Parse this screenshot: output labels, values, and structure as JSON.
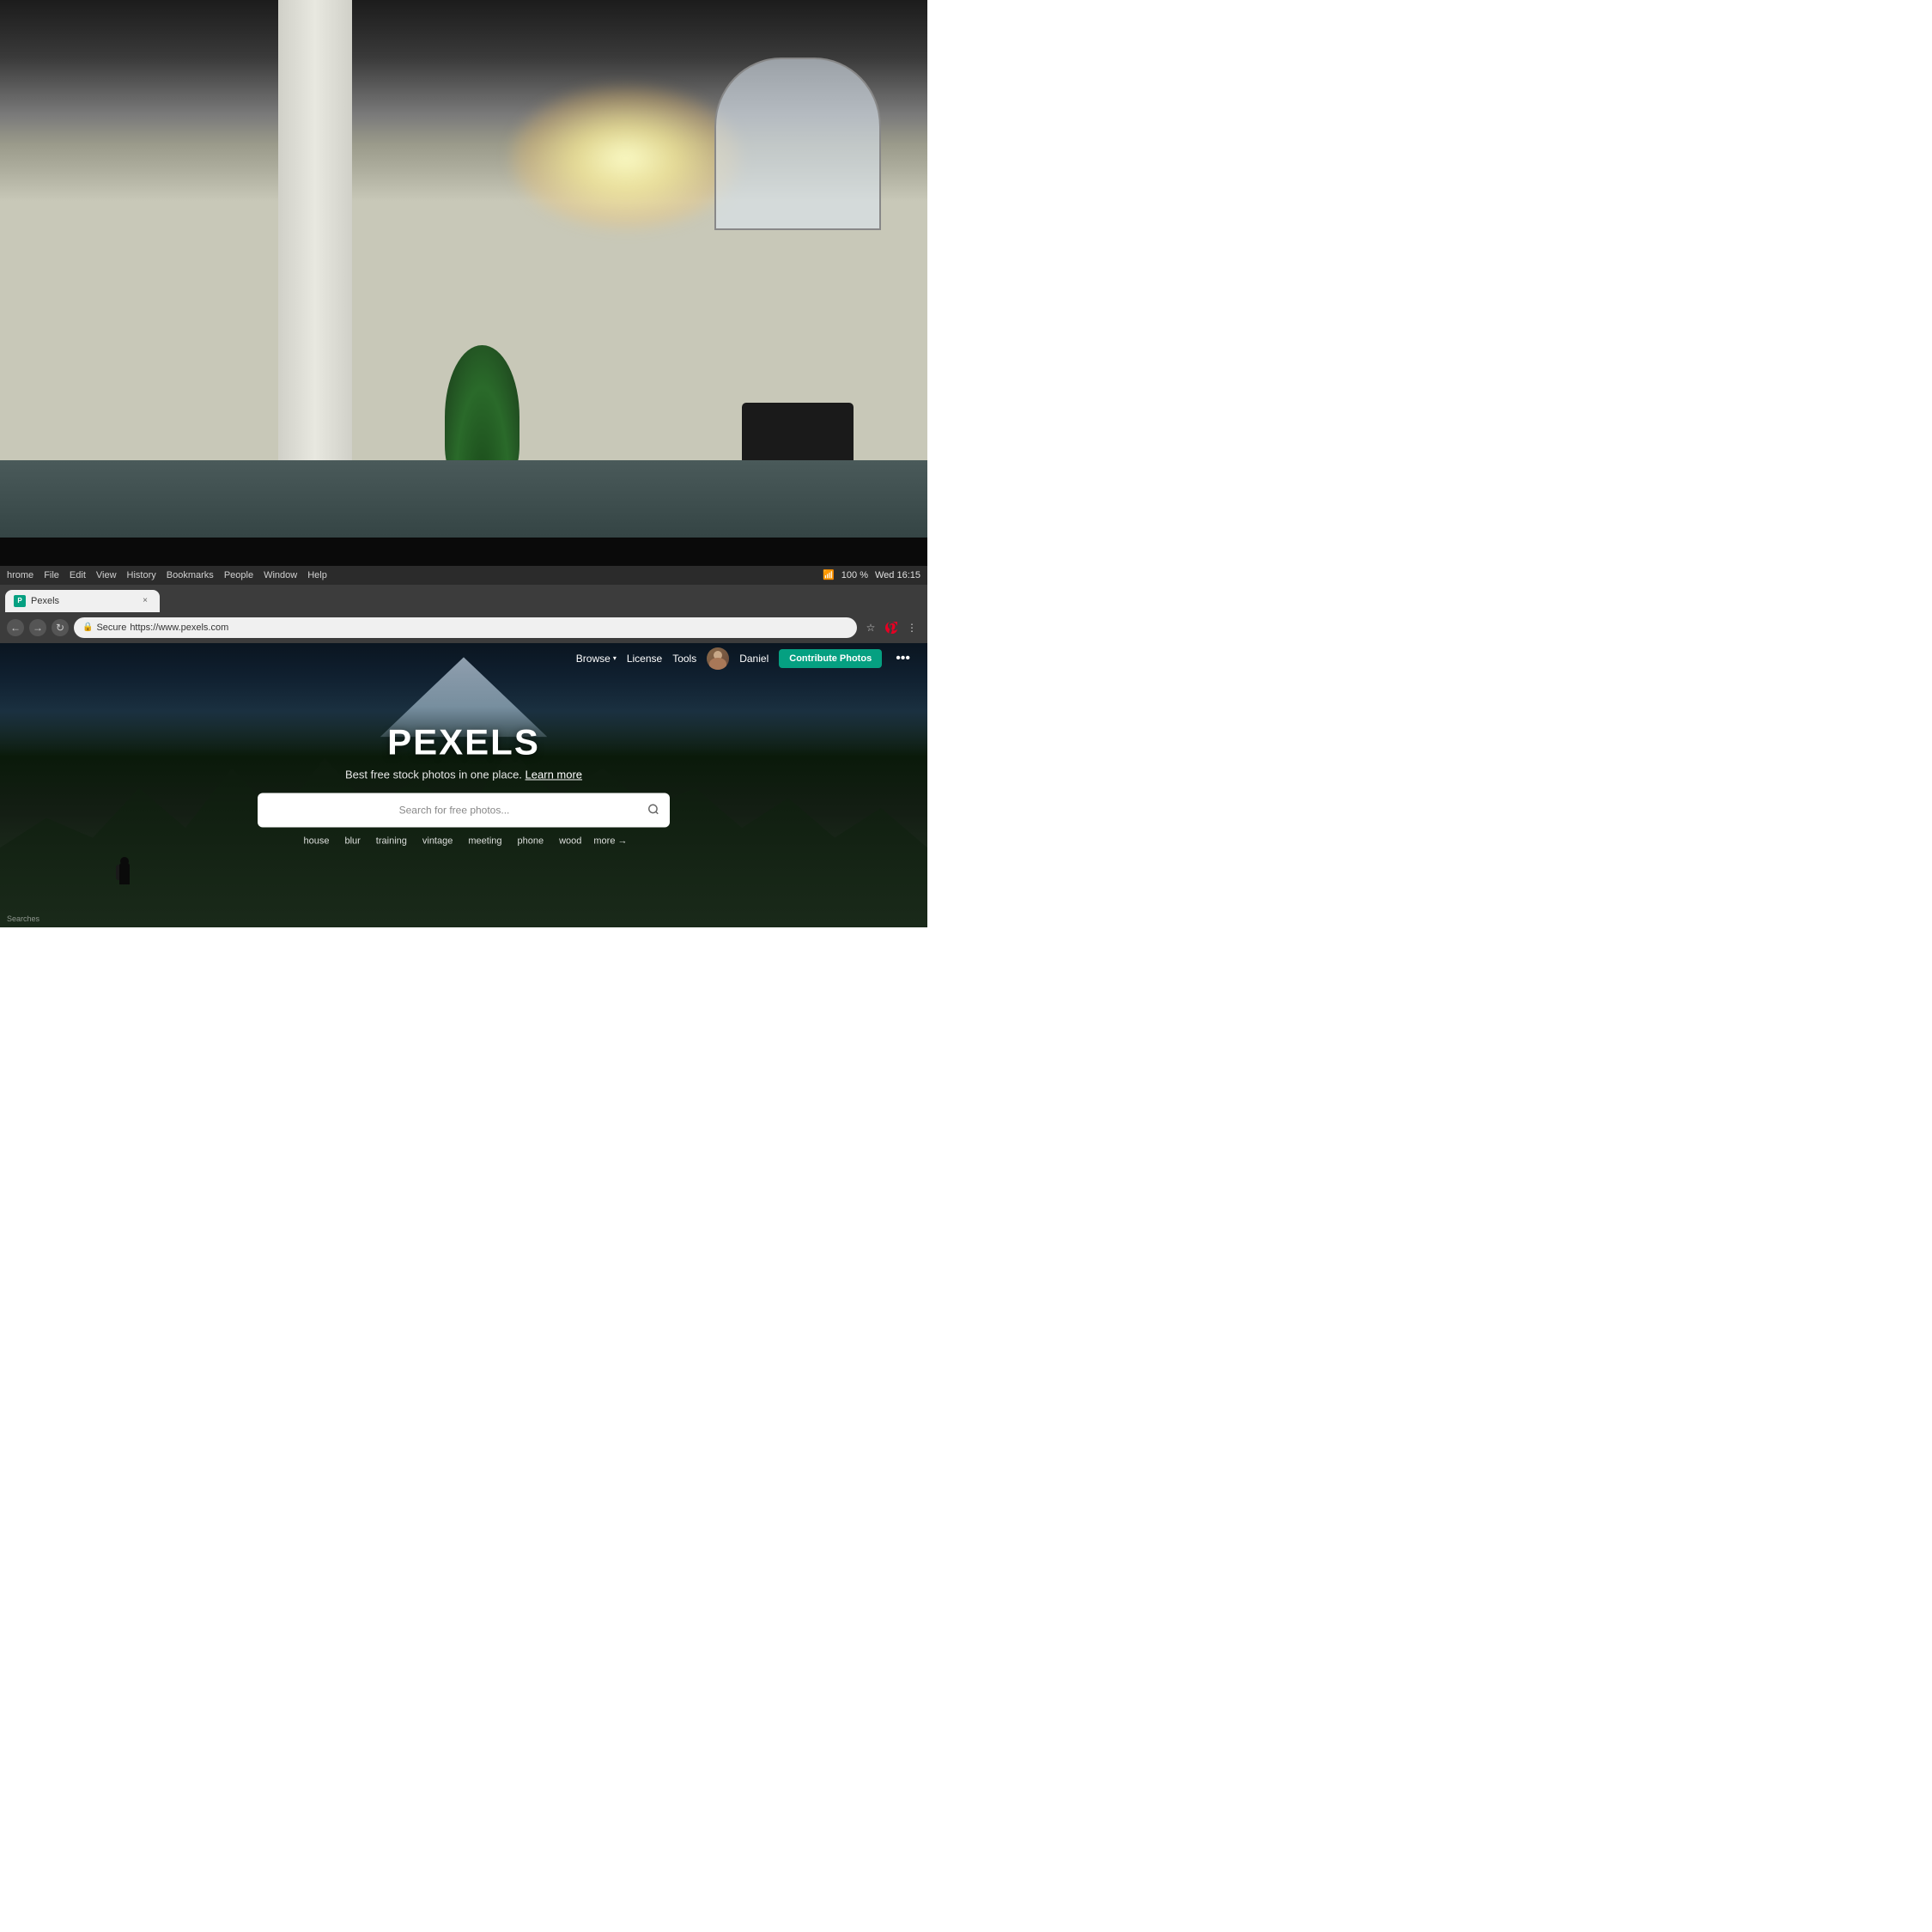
{
  "background": {
    "type": "office_workspace",
    "description": "Office interior with column, plants, chairs, bright window light"
  },
  "browser": {
    "menu_bar": {
      "app_name": "hrome",
      "items": [
        "File",
        "Edit",
        "View",
        "History",
        "Bookmarks",
        "People",
        "Window",
        "Help"
      ],
      "right_info": "Wed 16:15",
      "battery": "100 %"
    },
    "tab": {
      "favicon_letter": "P",
      "title": "Pexels",
      "close_label": "×"
    },
    "address_bar": {
      "back_icon": "←",
      "forward_icon": "→",
      "refresh_icon": "↻",
      "secure_label": "Secure",
      "url": "https://www.pexels.com",
      "bookmark_icon": "☆"
    }
  },
  "website": {
    "nav": {
      "browse_label": "Browse",
      "browse_arrow": "▾",
      "license_label": "License",
      "tools_label": "Tools",
      "user_name": "Daniel",
      "contribute_label": "Contribute Photos",
      "more_icon": "•••"
    },
    "hero": {
      "title": "PEXELS",
      "subtitle_text": "Best free stock photos in one place.",
      "subtitle_link": "Learn more",
      "search_placeholder": "Search for free photos...",
      "search_icon": "🔍",
      "tags": [
        "house",
        "blur",
        "training",
        "vintage",
        "meeting",
        "phone",
        "wood",
        "more →"
      ]
    }
  },
  "footer": {
    "searches_label": "Searches"
  }
}
